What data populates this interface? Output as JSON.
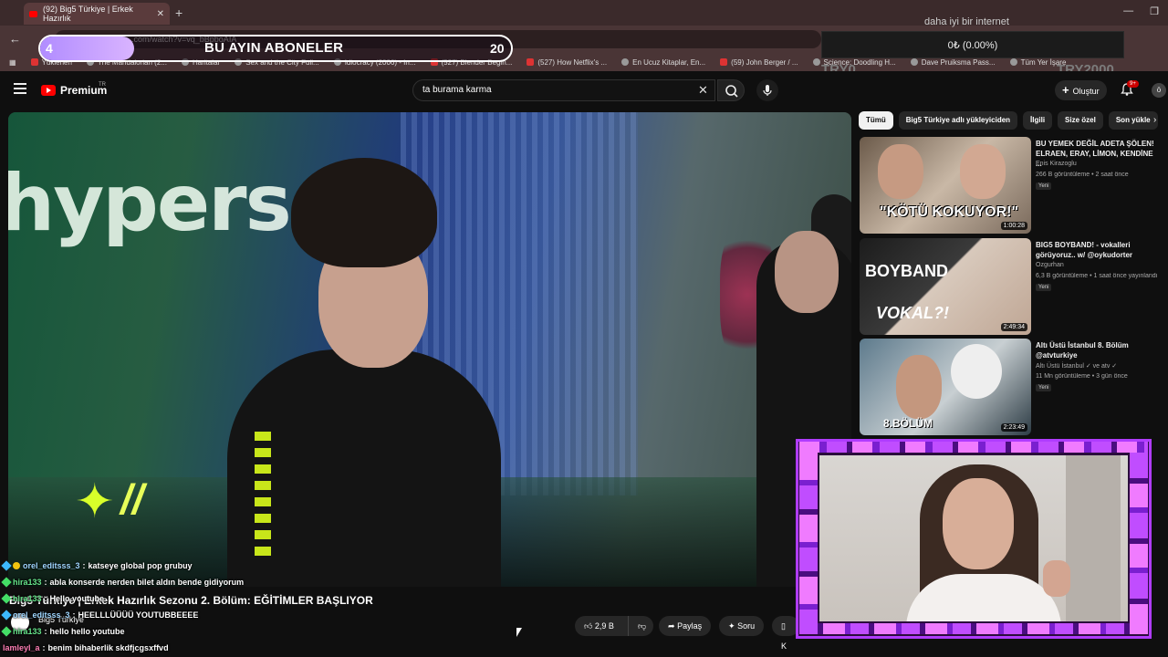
{
  "browser": {
    "tab_title": "(92) Big5 Türkiye | Erkek Hazırlık",
    "url": ".com/watch?v=vq_bBpboAIA",
    "bookmarks": [
      {
        "label": "Yüklenen",
        "icon": "youtube-icon"
      },
      {
        "label": "The Mandalorian (2...",
        "icon": "globe-icon"
      },
      {
        "label": "Haritalar",
        "icon": "maps-icon"
      },
      {
        "label": "Sex and the City Full...",
        "icon": "film-icon"
      },
      {
        "label": "Idiocracy (2006) - In...",
        "icon": "film-icon"
      },
      {
        "label": "(527) Blender Begin...",
        "icon": "youtube-icon"
      },
      {
        "label": "(527) How Netflix's ...",
        "icon": "youtube-icon"
      },
      {
        "label": "En Ucuz Kitaplar, En...",
        "icon": "book-icon"
      },
      {
        "label": "(59) John Berger / ...",
        "icon": "youtube-icon"
      },
      {
        "label": "Science: Doodling H...",
        "icon": "globe-icon"
      },
      {
        "label": "Dave Pruiksma Pass...",
        "icon": "image-icon"
      },
      {
        "label": "Tüm Yer İşare",
        "icon": "folder-icon"
      }
    ]
  },
  "overlay": {
    "goal": {
      "current": "4",
      "title": "BU AYIN ABONELER",
      "target": "20",
      "progress": 0.2
    },
    "donation": {
      "header": "daha iyi bir internet",
      "value": "0₺ (0.00%)",
      "left_label": "TRY0",
      "right_label": "TRY2000"
    }
  },
  "header": {
    "logo": "Premium",
    "logo_region": "TR",
    "search_value": "ta burama karma",
    "create_label": "Oluştur",
    "notifications": "9+",
    "avatar_letter": "ö"
  },
  "video": {
    "title": "Big5 Türkiye | Erkek Hazırlık Sezonu 2. Bölüm: EĞİTİMLER BAŞLIYOR",
    "channel": "Big5 Türkiye",
    "sign_text": "hypers",
    "actions": {
      "like": "2,9 B",
      "share": "Paylaş",
      "ask": "Soru",
      "save": "K"
    }
  },
  "chat": [
    {
      "user": "orel_editsss_3",
      "message": "katseye global pop grubuy",
      "color": "blue"
    },
    {
      "user": "hira133",
      "message": "abla konserde nerden bilet aldın bende gidiyorum",
      "color": "green"
    },
    {
      "user": "hira133",
      "message": "Hello youtube",
      "color": "green"
    },
    {
      "user": "orel_editsss_3",
      "message": "HEELLLÜÜÜÜ YOUTUBBEEEE",
      "color": "blue"
    },
    {
      "user": "hira133",
      "message": "hello hello youtube",
      "color": "green"
    },
    {
      "user": "lamleyl_a",
      "message": "benim bihaberlik skdfjcgsxffvd",
      "color": "pink"
    }
  ],
  "sidebar": {
    "chips": [
      "Tümü",
      "Big5 Türkiye adlı yükleyiciden",
      "İlgili",
      "Size özel",
      "Son yükle"
    ],
    "recommendations": [
      {
        "title": "BU YEMEK DEĞİL ADETA ŞÖLEN! ELRAEN, ERAY, LİMON, KENDİNE ...",
        "channel": "Enis Kirazoglu",
        "stats": "266 B görüntüleme • 2 saat önce",
        "badge": "Yeni",
        "duration": "1:00:28",
        "thumb_text": "\"KÖTÜ KOKUYOR!\""
      },
      {
        "title": "BIG5 BOYBAND! - vokalleri görüyoruz.. w/ @oykudorter",
        "channel": "Ozgurhan",
        "stats": "6,3 B görüntüleme • 1 saat önce yayınlandı",
        "badge": "Yeni",
        "duration": "2:49:34",
        "thumb_text": "BOYBAND",
        "thumb_text2": "VOKAL?!"
      },
      {
        "title": "Altı Üstü İstanbul 8. Bölüm @atvturkiye",
        "channel": "Altı Üstü İstanbul ✓ ve atv ✓",
        "stats": "11 Mn görüntüleme • 3 gün önce",
        "badge": "Yeni",
        "duration": "2:23:49",
        "thumb_text": "8.BÖLÜM"
      }
    ]
  }
}
